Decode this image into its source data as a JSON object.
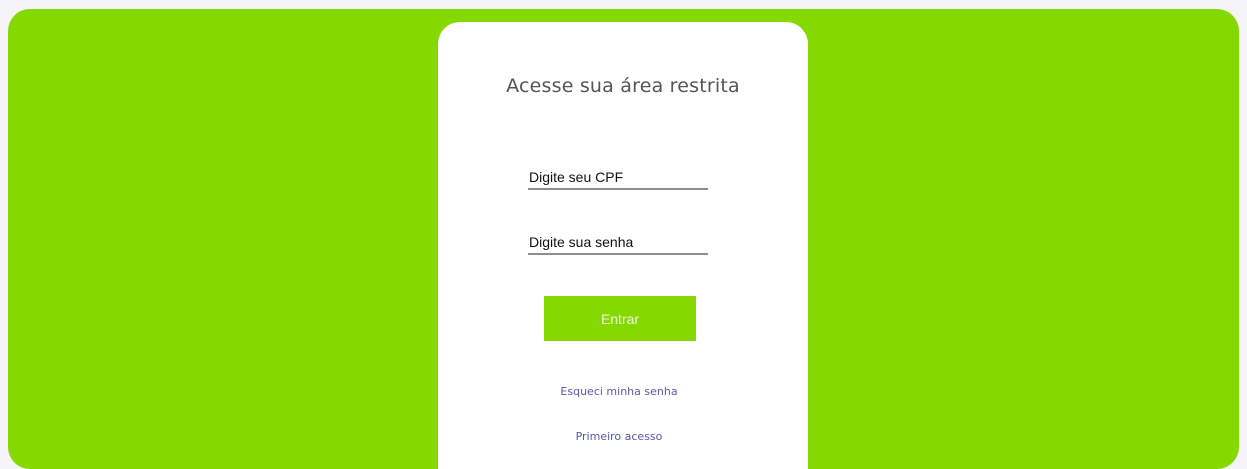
{
  "colors": {
    "accent": "#86d900",
    "card": "#ffffff",
    "link": "#5b57a8",
    "page_background": "#f6f4fb"
  },
  "login": {
    "title": "Acesse sua área restrita",
    "cpf": {
      "placeholder": "Digite seu CPF",
      "value": ""
    },
    "senha": {
      "placeholder": "Digite sua senha",
      "value": ""
    },
    "submit_label": "Entrar",
    "forgot_password_label": "Esqueci minha senha",
    "first_access_label": "Primeiro acesso"
  }
}
